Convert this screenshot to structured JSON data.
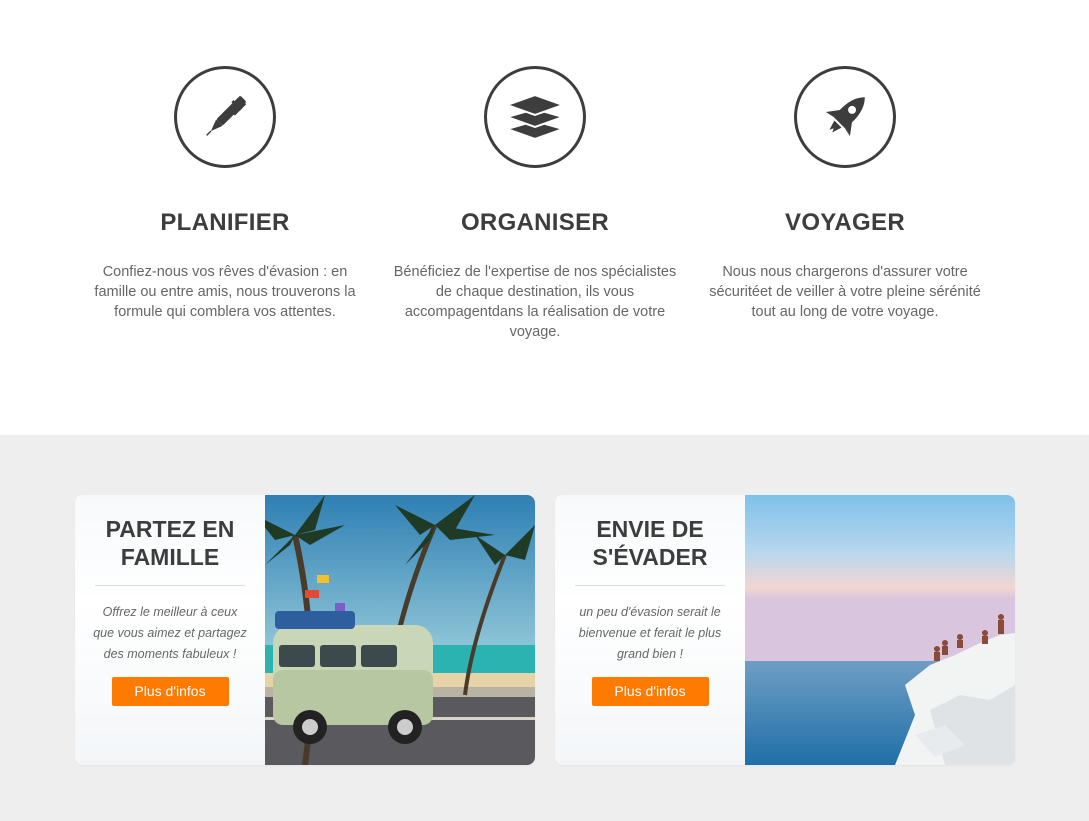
{
  "features": [
    {
      "icon": "pen-icon",
      "title": "PLANIFIER",
      "text": "Confiez-nous vos rêves d'évasion : en famille ou entre amis, nous trouverons la formule qui comblera vos attentes."
    },
    {
      "icon": "layers-icon",
      "title": "ORGANISER",
      "text": "Bénéficiez de l'expertise de nos spécialistes de chaque destination, ils vous accompagentdans la réalisation de votre voyage."
    },
    {
      "icon": "rocket-icon",
      "title": "VOYAGER",
      "text": "Nous nous chargerons d'assurer votre sécuritéet de veiller à votre pleine sérénité tout au long de votre voyage."
    }
  ],
  "cards": [
    {
      "title": "PARTEZ EN FAMILLE",
      "text": "Offrez le meilleur à ceux que vous aimez et partagez des moments fabuleux !",
      "button": "Plus d'infos",
      "image": "van-beach-palms-photo"
    },
    {
      "title": "ENVIE DE S'ÉVADER",
      "text": "un peu d'évasion serait le bienvenue et ferait le plus grand bien !",
      "button": "Plus d'infos",
      "image": "white-cliff-sea-photo"
    }
  ],
  "colors": {
    "accent": "#ff7a00",
    "heading": "#3d3d3d",
    "body_text": "#666666",
    "section_bg": "#eeeeee"
  }
}
